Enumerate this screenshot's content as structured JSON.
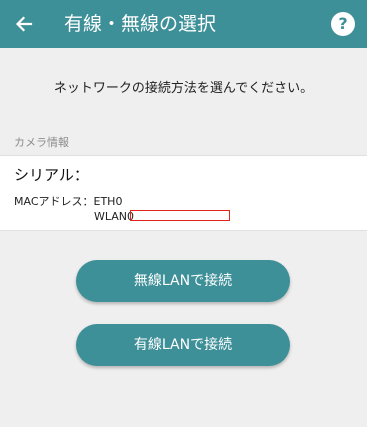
{
  "appbar": {
    "title": "有線・無線の選択",
    "back_icon": "arrow-left-icon",
    "help_icon": "help-icon",
    "help_glyph": "?"
  },
  "instruction": "ネットワークの接続方法を選んでください。",
  "camera_info": {
    "section_label": "カメラ情報",
    "serial_label": "シリアル：",
    "mac_label": "MACアドレス：ETH0",
    "wlan_label": "WLAN0"
  },
  "buttons": {
    "wireless": "無線LANで接続",
    "wired": "有線LANで接続"
  },
  "colors": {
    "primary": "#3d8f98",
    "background": "#efefef",
    "redaction": "#e0241b"
  }
}
